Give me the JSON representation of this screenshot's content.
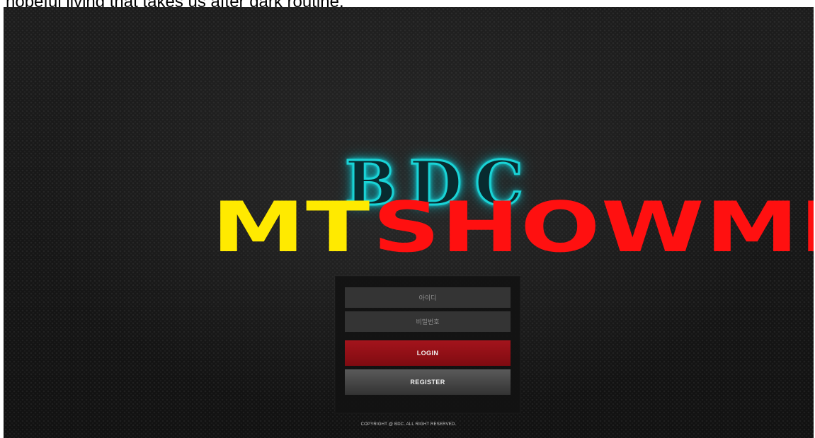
{
  "top_caption": "hopeful living that takes us after dark routine.",
  "logo": {
    "neon_letters": [
      "B",
      "D",
      "C"
    ],
    "mt_text": "MT",
    "showme_text": "SHOWME"
  },
  "form": {
    "username_placeholder": "아이디",
    "password_placeholder": "비밀번호",
    "login_label": "LOGIN",
    "register_label": "REGISTER"
  },
  "footer": {
    "copyright": "COPYRIGHT @ BDC. ALL RIGHT RESERVED."
  },
  "colors": {
    "mt": "#ffea00",
    "showme": "#ff1010",
    "neon": "#19d3d6",
    "login": "#8f1017",
    "register": "#4a4a4a"
  }
}
